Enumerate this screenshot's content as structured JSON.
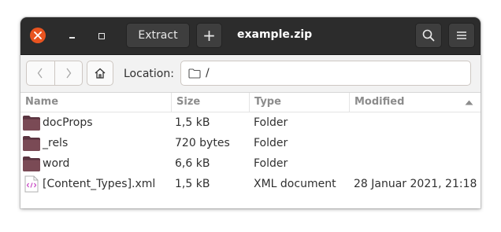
{
  "window": {
    "title": "example.zip",
    "extract_label": "Extract",
    "add_label": "+"
  },
  "toolbar": {
    "location_label": "Location:",
    "location_value": "/"
  },
  "list": {
    "columns": [
      "Name",
      "Size",
      "Type",
      "Modified"
    ],
    "sort_column": "Modified",
    "rows": [
      {
        "name": "docProps",
        "size": "1,5 kB",
        "type": "Folder",
        "modified": "",
        "icon": "folder-icon"
      },
      {
        "name": "_rels",
        "size": "720 bytes",
        "type": "Folder",
        "modified": "",
        "icon": "folder-icon"
      },
      {
        "name": "word",
        "size": "6,6 kB",
        "type": "Folder",
        "modified": "",
        "icon": "folder-icon"
      },
      {
        "name": "[Content_Types].xml",
        "size": "1,5 kB",
        "type": "XML document",
        "modified": "28 Januar 2021, 21:18",
        "icon": "xml-file-icon"
      }
    ]
  },
  "colors": {
    "headerbar": "#2c2c2c",
    "close_button": "#e95420",
    "folder": "#7a4a55",
    "xml_icon_accent": "#c43cc0"
  }
}
